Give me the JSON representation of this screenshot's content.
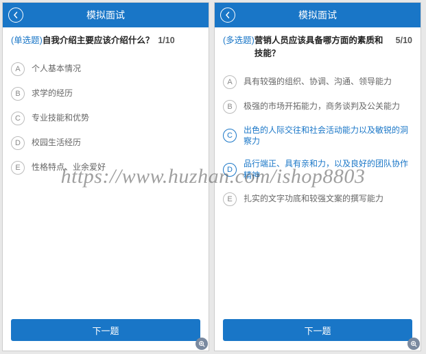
{
  "watermark": "https://www.huzhan.com/ishop8803",
  "screens": [
    {
      "header_title": "模拟面试",
      "question_type": "(单选题)",
      "question_text": "自我介绍主要应该介绍什么？",
      "progress": "1/10",
      "options": [
        {
          "letter": "A",
          "label": "个人基本情况",
          "selected": false
        },
        {
          "letter": "B",
          "label": "求学的经历",
          "selected": false
        },
        {
          "letter": "C",
          "label": "专业技能和优势",
          "selected": false
        },
        {
          "letter": "D",
          "label": "校园生活经历",
          "selected": false
        },
        {
          "letter": "E",
          "label": "性格特点、业余爱好",
          "selected": false
        }
      ],
      "next_label": "下一题"
    },
    {
      "header_title": "模拟面试",
      "question_type": "(多选题)",
      "question_text": "营销人员应该具备哪方面的素质和技能？",
      "progress": "5/10",
      "options": [
        {
          "letter": "A",
          "label": "具有较强的组织、协调、沟通、领导能力",
          "selected": false
        },
        {
          "letter": "B",
          "label": "极强的市场开拓能力，商务谈判及公关能力",
          "selected": false
        },
        {
          "letter": "C",
          "label": "出色的人际交往和社会活动能力以及敏锐的洞察力",
          "selected": true
        },
        {
          "letter": "D",
          "label": "品行端正、具有亲和力，以及良好的团队协作精神",
          "selected": true
        },
        {
          "letter": "E",
          "label": "扎实的文字功底和较强文案的撰写能力",
          "selected": false
        }
      ],
      "next_label": "下一题"
    }
  ]
}
